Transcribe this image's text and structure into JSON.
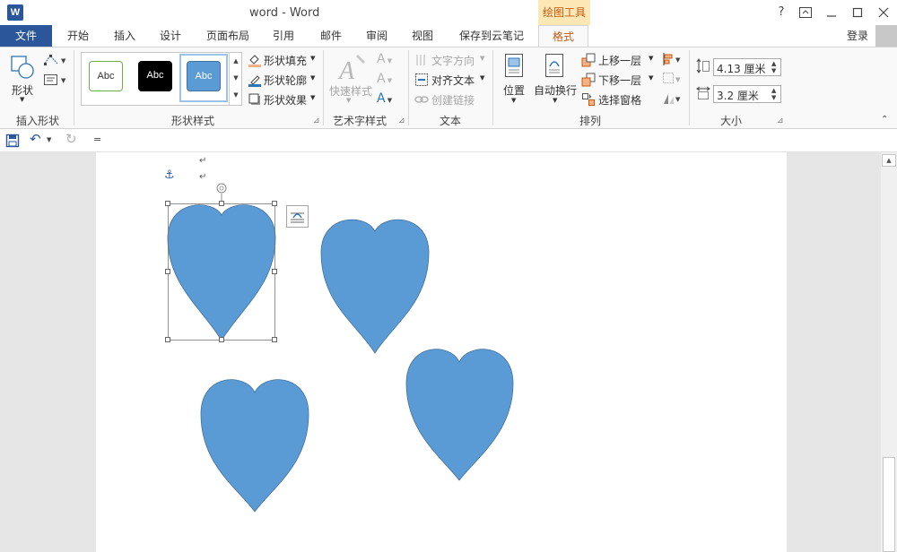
{
  "titlebar": {
    "app_icon": "W",
    "title": "word - Word",
    "context_group": "绘图工具",
    "help": "?",
    "restore": "□",
    "minimize": "—",
    "maximize": "☐",
    "close": "✕"
  },
  "tabs": {
    "file": "文件",
    "items": [
      "开始",
      "插入",
      "设计",
      "页面布局",
      "引用",
      "邮件",
      "审阅",
      "视图",
      "保存到云笔记"
    ],
    "format": "格式",
    "login": "登录"
  },
  "ribbon": {
    "insert_shapes": {
      "shapes_label": "形状",
      "group_label": "插入形状"
    },
    "shape_styles": {
      "presets": [
        "Abc",
        "Abc",
        "Abc"
      ],
      "fill": "形状填充",
      "outline": "形状轮廓",
      "effects": "形状效果",
      "group_label": "形状样式"
    },
    "wordart": {
      "quick_styles": "快速样式",
      "group_label": "艺术字样式"
    },
    "text": {
      "direction": "文字方向",
      "align": "对齐文本",
      "link": "创建链接",
      "group_label": "文本"
    },
    "arrange": {
      "position": "位置",
      "wrap": "自动换行",
      "bring_forward": "上移一层",
      "send_backward": "下移一层",
      "selection_pane": "选择窗格",
      "group_label": "排列"
    },
    "size": {
      "height": "4.13 厘米",
      "width": "3.2 厘米",
      "group_label": "大小"
    }
  },
  "colors": {
    "word_blue": "#2b579a",
    "context_orange": "#c55a11",
    "heart_fill": "#5b9bd5",
    "heart_stroke": "#41719c"
  },
  "icons": {
    "anchor": "⚓",
    "para_mark": "↵",
    "rotate": "↻",
    "save": "save-icon",
    "undo": "↶",
    "redo": "↻",
    "qat_more": "="
  }
}
